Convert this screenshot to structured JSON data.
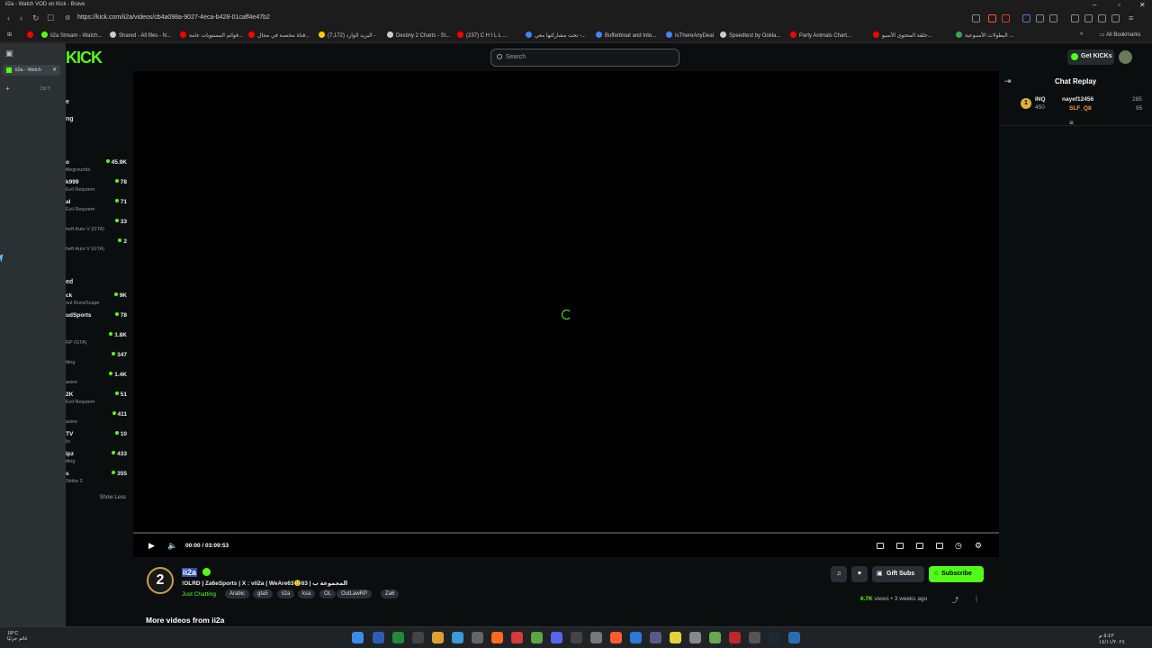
{
  "window": {
    "title": "ii2a - Watch VOD on Kick - Brave"
  },
  "address": {
    "url": "https://kick.com/ii2a/videos/cb4a098a-9027-4eca-b428-01caff4e47b2"
  },
  "bookmarks": [
    {
      "label": "ii2a Stream - Watch...",
      "color": "#53fc18"
    },
    {
      "label": "Shared - All files - N...",
      "color": "#cccccc"
    },
    {
      "label": "قوائم المستويات عامة...",
      "color": "#ff0000"
    },
    {
      "label": "قناة مختصة في مجال...",
      "color": "#ff0000"
    },
    {
      "label": "البريد الوارد (7,172) -",
      "color": "#ffcc00"
    },
    {
      "label": "Destiny 2 Charts - St...",
      "color": "#cccccc"
    },
    {
      "label": "(237) C H I L L ...",
      "color": "#ff0000"
    },
    {
      "label": "تحت مشاركتها معي -...",
      "color": "#4285f4"
    },
    {
      "label": "Bufferbloat and Inte...",
      "color": "#4285f4"
    },
    {
      "label": "IsThereAnyDeal",
      "color": "#4285f4"
    },
    {
      "label": "Speedtest by Ookla...",
      "color": "#cccccc"
    },
    {
      "label": "Party Animals Chart...",
      "color": "#ff0000"
    },
    {
      "label": "حلقة المحتوى الأسبو...",
      "color": "#ff0000"
    },
    {
      "label": "البطولات الأسبوعية ...",
      "color": "#34a853"
    }
  ],
  "all_bookmarks": "All Bookmarks",
  "tabpanel": {
    "tab_label": "ii2a - Watch",
    "new_tab_hint": "Ctrl T"
  },
  "page": {
    "logo": "KICK",
    "search_placeholder": "Search",
    "get_kicks": "Get KICKs"
  },
  "sidebar": {
    "sections": [
      {
        "label": "e",
        "offset": "top"
      },
      {
        "label": "ng",
        "offset": "mid"
      }
    ],
    "group1": [
      {
        "name": "o",
        "game": "ttlegrounds",
        "viewers": "45.9K"
      },
      {
        "name": "k999",
        "game": "Evil Requiem",
        "viewers": "78"
      },
      {
        "name": "al",
        "game": "Evil Requiem",
        "viewers": "71"
      },
      {
        "name": "",
        "game": "heft Auto V (GTA)",
        "viewers": "33"
      },
      {
        "name": "",
        "game": "heft Auto V (GTA)",
        "viewers": "2"
      }
    ],
    "section2": "ed",
    "group2": [
      {
        "name": "ck",
        "game": "ool RuneScape",
        "viewers": "9K"
      },
      {
        "name": "udSports",
        "game": "",
        "viewers": "78"
      },
      {
        "name": "",
        "game": "RP (GTA)",
        "viewers": "1.8K"
      },
      {
        "name": "",
        "game": "tting",
        "viewers": "347"
      },
      {
        "name": "",
        "game": "asino",
        "viewers": "1.4K"
      },
      {
        "name": "2K",
        "game": "Evil Requiem",
        "viewers": "51"
      },
      {
        "name": "",
        "game": "asino",
        "viewers": "411"
      },
      {
        "name": "TV",
        "game": "lic",
        "viewers": "10"
      },
      {
        "name": "ipz",
        "game": "tting",
        "viewers": "433"
      },
      {
        "name": "s",
        "game": "Strike 2",
        "viewers": "355"
      }
    ],
    "show_less": "Show Less"
  },
  "player": {
    "timecode": "00:00 / 03:09:53",
    "progress": 0.0
  },
  "chat": {
    "title": "Chat Replay",
    "leaderboard": {
      "rank": "1",
      "first": {
        "name": "INQ",
        "score": "450"
      },
      "second": {
        "name": "nayef12456",
        "score": "285"
      },
      "third": {
        "name": "SLF_Q8",
        "score": "95"
      }
    }
  },
  "channel": {
    "name": "ii2a",
    "avatar_letter": "2",
    "title": "!OLRD | Za6eSports | X : vii2a | WeAre63🙂63 | المجموعة ب",
    "category": "Just Chatting",
    "tags": [
      "Arabic",
      "gta5",
      "ii2a",
      "ksa",
      "OL",
      "OutLawRP",
      "Za6"
    ],
    "gift_subs": "Gift Subs",
    "subscribe": "Subscribe",
    "views": "6.7K",
    "views_label": "views",
    "age": "3 weeks ago",
    "more_videos": "More videos from ii2a"
  },
  "taskbar": {
    "weather_temp": "18°C",
    "weather_desc": "غائم جزئيًا",
    "time": "٥:٤٣ م",
    "date": "١٤/١١/٢٠٢٤"
  }
}
